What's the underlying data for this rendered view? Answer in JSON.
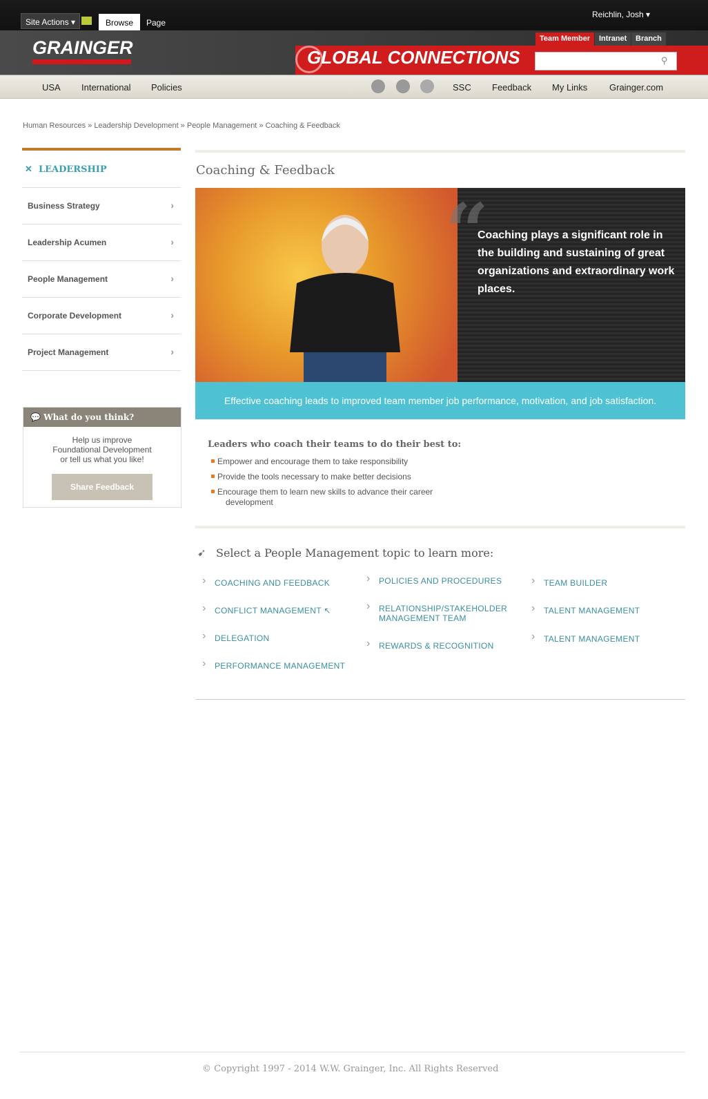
{
  "top": {
    "site_actions": "Site Actions",
    "browse": "Browse",
    "page": "Page",
    "user": "Reichlin, Josh"
  },
  "brand": {
    "logo": "GRAINGER",
    "banner": "GLOBAL CONNECTIONS",
    "tabs": [
      "Team Member",
      "Intranet",
      "Branch"
    ]
  },
  "nav": {
    "left": [
      "USA",
      "International",
      "Policies"
    ],
    "right": [
      "SSC",
      "Feedback",
      "My Links",
      "Grainger.com"
    ]
  },
  "breadcrumb": "Human Resources » Leadership Development » People Management » Coaching & Feedback",
  "sidebar": {
    "heading": "LEADERSHIP",
    "items": [
      "Business Strategy",
      "Leadership Acumen",
      "People Management",
      "Corporate Development",
      "Project Management"
    ]
  },
  "feedback": {
    "heading": "What do you think?",
    "line1": "Help us improve",
    "line2": "Foundational Development",
    "line3": "or tell us what you like!",
    "button": "Share Feedback"
  },
  "main": {
    "title": "Coaching & Feedback",
    "quote": "Coaching plays a significant role in the building and sustaining of great organizations and extraordinary work places.",
    "banner": "Effective coaching leads to improved team member job performance, motivation, and job satisfaction.",
    "lead": "Leaders who coach their teams to do their best to:",
    "bullets": [
      "Empower and encourage them to take responsibility",
      "Provide the tools necessary to make better decisions",
      "Encourage them to learn new skills to advance their career",
      "development"
    ],
    "select": "Select a People Management topic to learn more:",
    "topics": [
      "COACHING AND FEEDBACK",
      "CONFLICT MANAGEMENT ↖",
      "DELEGATION",
      "PERFORMANCE MANAGEMENT",
      "POLICIES AND PROCEDURES",
      "RELATIONSHIP/STAKEHOLDER",
      "MANAGEMENT TEAM",
      "REWARDS & RECOGNITION",
      "TEAM BUILDER",
      "TALENT MANAGEMENT",
      "TALENT MANAGEMENT"
    ]
  },
  "footer": "© Copyright 1997 - 2014 W.W. Grainger, Inc. All Rights Reserved"
}
